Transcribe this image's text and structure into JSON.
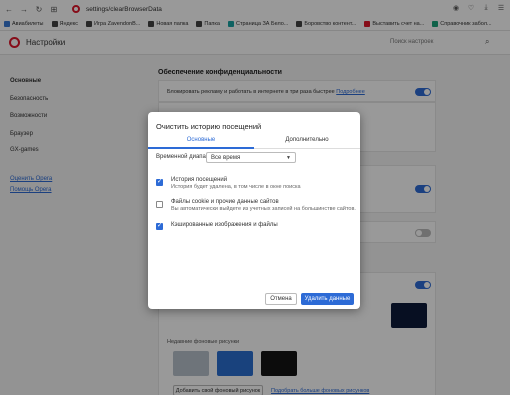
{
  "browser": {
    "url": "settings/clearBrowserData",
    "nav": {
      "back": "←",
      "forward": "→",
      "reload": "↻",
      "grid": "⊞"
    }
  },
  "bookmarks": [
    {
      "label": "Авиабилеты",
      "color": "#3a7bd5"
    },
    {
      "label": "Яндекс",
      "color": "#444444"
    },
    {
      "label": "Игра ZavendonB...",
      "color": "#444444"
    },
    {
      "label": "Новая папка",
      "color": "#444444"
    },
    {
      "label": "Папка",
      "color": "#444444"
    },
    {
      "label": "Страница ЗА Бело...",
      "color": "#1aa3a3"
    },
    {
      "label": "Боровство контент...",
      "color": "#444444"
    },
    {
      "label": "Выставить счет на...",
      "color": "#e0162b"
    },
    {
      "label": "Справочник забол...",
      "color": "#1aa37a"
    }
  ],
  "settings": {
    "title": "Настройки",
    "search_placeholder": "Поиск настроек",
    "sidebar": {
      "items": [
        "Основные",
        "Безопасность",
        "Возможности",
        "Браузер",
        "GX-games"
      ],
      "links": [
        "Оценить Opera",
        "Помощь Opera"
      ]
    },
    "section_title": "Обеспечение конфиденциальности",
    "adblock_text": "Блокировать рекламу и работать в интернете в три раза быстрее",
    "adblock_link": "Подробнее",
    "wallpapers_label": "Недавние фоновые рисунки",
    "add_wallpaper": "Добавить свой фоновый рисунок",
    "more_wallpapers": "Подобрать больше фоновых рисунков"
  },
  "dialog": {
    "title": "Очистить историю посещений",
    "tabs": [
      "Основные",
      "Дополнительно"
    ],
    "range_label": "Временной диапазон",
    "range_value": "Все время",
    "options": [
      {
        "title": "История посещений",
        "subtitle": "История будет удалена, в том числе в окне поиска",
        "checked": true
      },
      {
        "title": "Файлы cookie и прочие данные сайтов",
        "subtitle": "Вы автоматически выйдете из учетных записей на большинстве сайтов.",
        "checked": false
      },
      {
        "title": "Кэшированные изображения и файлы",
        "subtitle": "",
        "checked": true
      }
    ],
    "cancel_label": "Отмена",
    "delete_label": "Удалить данные"
  },
  "colors": {
    "accent": "#2d6bd6",
    "opera": "#e0162b"
  }
}
